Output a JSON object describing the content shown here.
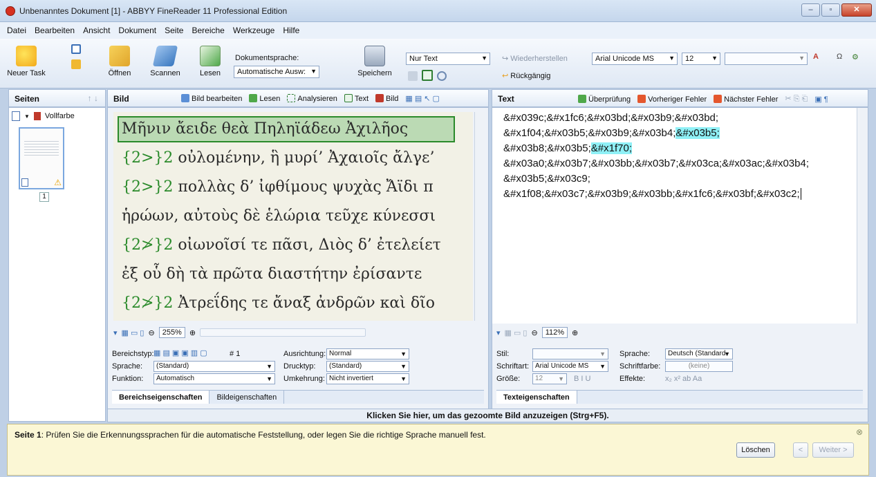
{
  "window": {
    "title": "Unbenanntes Dokument [1] - ABBYY FineReader 11 Professional Edition"
  },
  "menu": [
    "Datei",
    "Bearbeiten",
    "Ansicht",
    "Dokument",
    "Seite",
    "Bereiche",
    "Werkzeuge",
    "Hilfe"
  ],
  "ribbon": {
    "new_task": "Neuer Task",
    "open": "Öffnen",
    "scan": "Scannen",
    "read": "Lesen",
    "doc_language_label": "Dokumentsprache:",
    "doc_language_value": "Automatische Ausw:",
    "save": "Speichern",
    "save_format": "Nur Text",
    "redo": "Wiederherstellen",
    "undo": "Rückgängig",
    "font": "Arial Unicode MS",
    "font_size": "12",
    "style_value": ""
  },
  "pages_pane": {
    "title": "Seiten",
    "color_mode": "Vollfarbe",
    "page_number": "1"
  },
  "image_pane": {
    "title": "Bild",
    "toolbar": [
      "Bild bearbeiten",
      "Lesen",
      "Analysieren",
      "Text",
      "Bild"
    ],
    "lines": [
      "Μῆνιν ἄειδε θεὰ Πηληϊάδεω Ἀχιλῆος",
      "{2>}2 οὐλομένην, ἣ μυρί’ Ἀχαιοῖς ἄλγε’",
      "{2>}2 πολλὰς δ’ ἰφθίμους ψυχὰς Ἄϊδι π",
      "ἡρώων, αὐτοὺς δὲ ἑλώρια τεῦχε κύνεσσι",
      "{2≯}2 οἰωνοῖσί τε πᾶσι, Διὸς δ’ ἐτελείετ",
      "ἐξ οὗ δὴ τὰ πρῶτα διαστήτην ἐρίσαντε",
      "{2≯}2 Ἀτρεΐδης τε ἄναξ ἀνδρῶν καὶ δῖο"
    ],
    "zoom": "255%",
    "props": {
      "area_type_label": "Bereichstyp:",
      "area_number": "1",
      "language_label": "Sprache:",
      "language_value": "(Standard)",
      "function_label": "Funktion:",
      "function_value": "Automatisch",
      "alignment_label": "Ausrichtung:",
      "alignment_value": "Normal",
      "print_type_label": "Drucktyp:",
      "print_type_value": "(Standard)",
      "inversion_label": "Umkehrung:",
      "inversion_value": "Nicht invertiert"
    },
    "tabs": [
      "Bereichseigenschaften",
      "Bildeigenschaften"
    ]
  },
  "text_pane": {
    "title": "Text",
    "toolbar": [
      "Überprüfung",
      "Vorheriger Fehler",
      "Nächster Fehler"
    ],
    "lines": [
      {
        "pre": "&#x039c;&#x1fc6;&#x03bd;&#x03b9;&#x03bd;",
        "hl": "",
        "post": ""
      },
      {
        "pre": "&#x1f04;&#x03b5;&#x03b9;&#x03b4;",
        "hl": "&#x03b5;",
        "post": ""
      },
      {
        "pre": "&#x03b8;&#x03b5;",
        "hl": "&#x1f70;",
        "post": ""
      },
      {
        "pre": "&#x03a0;&#x03b7;&#x03bb;&#x03b7;&#x03ca;&#x03ac;&#x03b4;",
        "hl": "",
        "post": ""
      },
      {
        "pre": "&#x03b5;&#x03c9;",
        "hl": "",
        "post": ""
      },
      {
        "pre": "&#x1f08;&#x03c7;&#x03b9;&#x03bb;&#x1fc6;&#x03bf;&#x03c2;",
        "hl": "",
        "post": ""
      }
    ],
    "zoom": "112%",
    "props": {
      "style_label": "Stil:",
      "language_label": "Sprache:",
      "language_value": "Deutsch (Standard",
      "font_label": "Schriftart:",
      "font_value": "Arial Unicode MS",
      "font_color_label": "Schriftfarbe:",
      "font_color_value": "(keine)",
      "size_label": "Größe:",
      "size_value": "12",
      "effects_label": "Effekte:"
    },
    "tabs": [
      "Texteigenschaften"
    ]
  },
  "zoom_hint": "Klicken Sie hier, um das gezoomte Bild anzuzeigen (Strg+F5).",
  "tip": {
    "page_label": "Seite 1",
    "message": ": Prüfen Sie die Erkennungssprachen für die automatische Feststellung, oder legen Sie die richtige Sprache manuell fest.",
    "delete": "Löschen",
    "back": "<",
    "next": "Weiter >"
  }
}
